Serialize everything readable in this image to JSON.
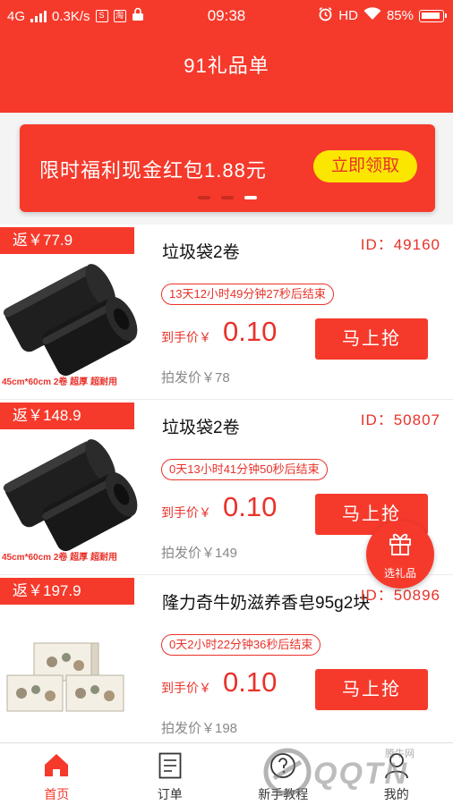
{
  "status_bar": {
    "network": "4G",
    "speed": "0.3K/s",
    "icon_s": "S",
    "icon_tao": "淘",
    "time": "09:38",
    "hd": "HD",
    "battery": "85%"
  },
  "header": {
    "title": "91礼品单"
  },
  "banner": {
    "text": "限时福利现金红包1.88元",
    "button_label": "立即领取",
    "active_dot": 3,
    "dot_count": 3
  },
  "products": [
    {
      "rebate": "返￥77.9",
      "name": "垃圾袋2卷",
      "id": "ID：49160",
      "countdown": "13天12小时49分钟27秒后结束",
      "price_label": "到手价￥",
      "price": "0.10",
      "buy_label": "马上抢",
      "original_price": "拍发价￥78",
      "image_caption": "45cm*60cm 2卷 超厚 超耐用",
      "image": "black-trash-bag-rolls"
    },
    {
      "rebate": "返￥148.9",
      "name": "垃圾袋2卷",
      "id": "ID：50807",
      "countdown": "0天13小时41分钟50秒后结束",
      "price_label": "到手价￥",
      "price": "0.10",
      "buy_label": "马上抢",
      "original_price": "拍发价￥149",
      "image_caption": "45cm*60cm 2卷 超厚 超耐用",
      "image": "black-trash-bag-rolls"
    },
    {
      "rebate": "返￥197.9",
      "name": "隆力奇牛奶滋养香皂95g2块",
      "id": "ID：50896",
      "countdown": "0天2小时22分钟36秒后结束",
      "price_label": "到手价￥",
      "price": "0.10",
      "buy_label": "马上抢",
      "original_price": "拍发价￥198",
      "image_caption": "",
      "image": "soap-boxes"
    }
  ],
  "float_button": {
    "label": "选礼品",
    "icon": "gift-icon"
  },
  "tabbar": [
    {
      "label": "首页",
      "icon": "home-icon",
      "active": true
    },
    {
      "label": "订单",
      "icon": "document-icon",
      "active": false
    },
    {
      "label": "新手教程",
      "icon": "guide-icon",
      "active": false
    },
    {
      "label": "我的",
      "icon": "user-icon",
      "active": false
    }
  ],
  "watermark": {
    "text": "QQTN",
    "sub": "腾牛网"
  },
  "colors": {
    "primary": "#f53a2c",
    "accent_yellow": "#fbe600",
    "text_red": "#e8322a"
  }
}
